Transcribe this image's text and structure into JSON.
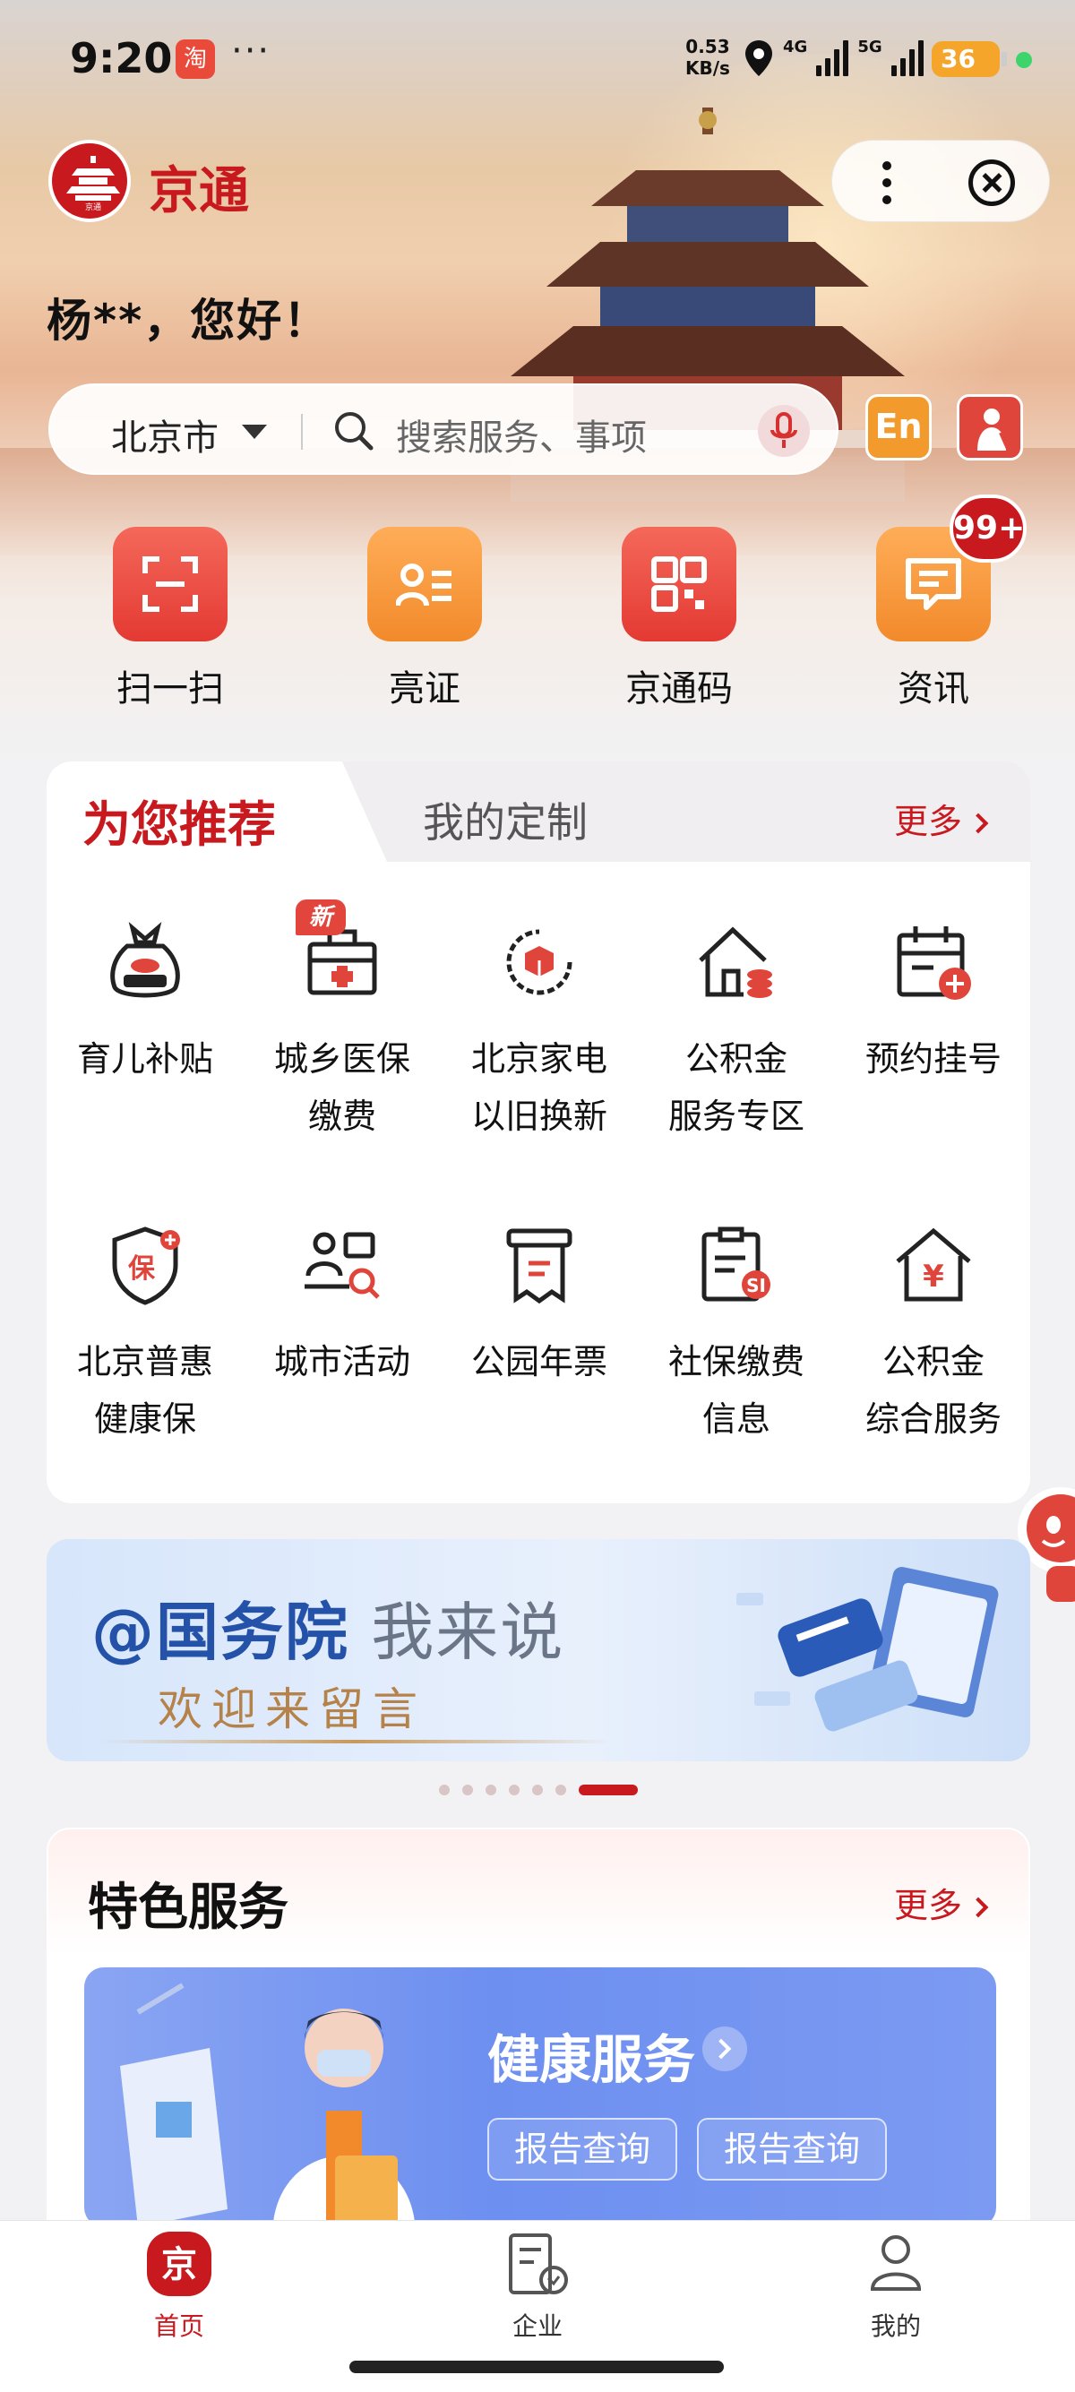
{
  "status_bar": {
    "time": "9:20",
    "app_icon_text": "淘",
    "more_dots": "···",
    "net_speed_value": "0.53",
    "net_speed_unit": "KB/s",
    "signal1_label": "4G",
    "signal2_label": "5G",
    "battery": "36"
  },
  "header": {
    "app_name": "京通",
    "greeting": "杨**，您好！"
  },
  "search": {
    "city": "北京市",
    "placeholder": "搜索服务、事项"
  },
  "toolbar": {
    "english_label": "En"
  },
  "quick_actions": [
    {
      "label": "扫一扫",
      "icon": "scan-icon"
    },
    {
      "label": "亮证",
      "icon": "id-card-icon"
    },
    {
      "label": "京通码",
      "icon": "qr-code-icon"
    },
    {
      "label": "资讯",
      "icon": "message-icon",
      "badge": "99+"
    }
  ],
  "recommend": {
    "tab_active": "为您推荐",
    "tab_other": "我的定制",
    "more": "更多",
    "new_badge": "新",
    "items": [
      {
        "line1": "育儿补贴",
        "line2": "",
        "icon": "childcare-subsidy-icon"
      },
      {
        "line1": "城乡医保",
        "line2": "缴费",
        "icon": "medical-kit-icon"
      },
      {
        "line1": "北京家电",
        "line2": "以旧换新",
        "icon": "appliance-trade-in-icon"
      },
      {
        "line1": "公积金",
        "line2": "服务专区",
        "icon": "housing-fund-icon"
      },
      {
        "line1": "预约挂号",
        "line2": "",
        "icon": "appointment-calendar-icon"
      },
      {
        "line1": "北京普惠",
        "line2": "健康保",
        "icon": "insurance-shield-icon"
      },
      {
        "line1": "城市活动",
        "line2": "",
        "icon": "city-activity-icon"
      },
      {
        "line1": "公园年票",
        "line2": "",
        "icon": "park-ticket-icon"
      },
      {
        "line1": "社保缴费",
        "line2": "信息",
        "icon": "social-security-icon"
      },
      {
        "line1": "公积金",
        "line2": "综合服务",
        "icon": "housing-fund-yuan-icon"
      }
    ]
  },
  "banner": {
    "title_bold": "@国务院",
    "title_light": " 我来说",
    "subtitle": "欢迎来留言"
  },
  "features": {
    "title": "特色服务",
    "more": "更多",
    "health_title": "健康服务",
    "buttons": [
      "报告查询",
      "报告查询"
    ]
  },
  "tabbar": [
    {
      "label": "首页",
      "icon": "home-jing-icon",
      "active": true
    },
    {
      "label": "企业",
      "icon": "enterprise-icon",
      "active": false
    },
    {
      "label": "我的",
      "icon": "profile-icon",
      "active": false
    }
  ],
  "colors": {
    "brand_red": "#c8191f",
    "accent_orange": "#f29a2c",
    "health_blue": "#6d8ff0"
  }
}
